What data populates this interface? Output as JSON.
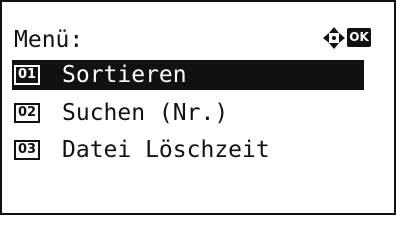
{
  "header": {
    "title": "Menü:",
    "nav_icon": "four-way-arrow-icon",
    "ok_label": "OK"
  },
  "menu": {
    "items": [
      {
        "number": "01",
        "label": "Sortieren",
        "selected": true
      },
      {
        "number": "02",
        "label": "Suchen (Nr.)",
        "selected": false
      },
      {
        "number": "03",
        "label": "Datei Löschzeit",
        "selected": false
      }
    ]
  },
  "colors": {
    "foreground": "#111111",
    "background": "#ffffff"
  }
}
